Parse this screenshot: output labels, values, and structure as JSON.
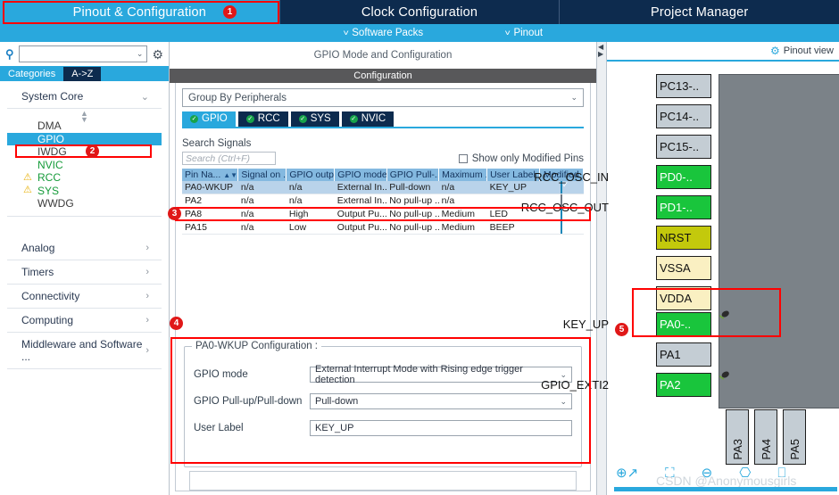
{
  "tabs": [
    {
      "label": "Pinout & Configuration",
      "active": true
    },
    {
      "label": "Clock Configuration",
      "active": false
    },
    {
      "label": "Project Manager",
      "active": false
    }
  ],
  "subbar": {
    "software_packs": "Software Packs",
    "pinout": "Pinout",
    "chevron": "˅"
  },
  "sidebar": {
    "search_value": "",
    "view_tabs": [
      {
        "label": "Categories",
        "active": false
      },
      {
        "label": "A->Z",
        "active": true
      }
    ],
    "groups": [
      {
        "label": "System Core",
        "expanded": true,
        "items": [
          {
            "label": "DMA",
            "state": "normal"
          },
          {
            "label": "GPIO",
            "state": "selected"
          },
          {
            "label": "IWDG",
            "state": "normal"
          },
          {
            "label": "NVIC",
            "state": "configured"
          },
          {
            "label": "RCC",
            "state": "warning"
          },
          {
            "label": "SYS",
            "state": "warning"
          },
          {
            "label": "WWDG",
            "state": "normal"
          }
        ]
      },
      {
        "label": "Analog",
        "expanded": false,
        "items": []
      },
      {
        "label": "Timers",
        "expanded": false,
        "items": []
      },
      {
        "label": "Connectivity",
        "expanded": false,
        "items": []
      },
      {
        "label": "Computing",
        "expanded": false,
        "items": []
      },
      {
        "label": "Middleware and Software ...",
        "expanded": false,
        "items": []
      }
    ]
  },
  "center": {
    "mode_header": "GPIO Mode and Configuration",
    "config_header": "Configuration",
    "group_by": "Group By Peripherals",
    "peripheral_tabs": [
      {
        "label": "GPIO",
        "active": true
      },
      {
        "label": "RCC",
        "active": false
      },
      {
        "label": "SYS",
        "active": false
      },
      {
        "label": "NVIC",
        "active": false
      }
    ],
    "search_label": "Search Signals",
    "search_placeholder": "Search (Ctrl+F)",
    "show_modified_label": "Show only Modified Pins",
    "show_modified_checked": false,
    "table": {
      "headers": [
        "Pin Na...",
        "Signal on ...",
        "GPIO outp...",
        "GPIO mode",
        "GPIO Pull-...",
        "Maximum ...",
        "User Label",
        "Modified"
      ],
      "rows": [
        {
          "cells": [
            "PA0-WKUP",
            "n/a",
            "n/a",
            "External In...",
            "Pull-down",
            "n/a",
            "KEY_UP"
          ],
          "modified": true,
          "selected": true
        },
        {
          "cells": [
            "PA2",
            "n/a",
            "n/a",
            "External In...",
            "No pull-up ...",
            "n/a",
            ""
          ],
          "modified": false,
          "selected": false
        },
        {
          "cells": [
            "PA8",
            "n/a",
            "High",
            "Output Pu...",
            "No pull-up ...",
            "Medium",
            "LED"
          ],
          "modified": true,
          "selected": false
        },
        {
          "cells": [
            "PA15",
            "n/a",
            "Low",
            "Output Pu...",
            "No pull-up ...",
            "Medium",
            "BEEP"
          ],
          "modified": true,
          "selected": false
        }
      ]
    },
    "config": {
      "title": "PA0-WKUP Configuration :",
      "fields": [
        {
          "label": "GPIO mode",
          "value": "External Interrupt Mode with Rising edge trigger detection",
          "type": "select"
        },
        {
          "label": "GPIO Pull-up/Pull-down",
          "value": "Pull-down",
          "type": "select"
        },
        {
          "label": "User Label",
          "value": "KEY_UP",
          "type": "text"
        }
      ]
    }
  },
  "pinout": {
    "view_label": "Pinout view",
    "left_pins": [
      {
        "name": "PC13-..",
        "color": "grey",
        "label": "",
        "tack": false
      },
      {
        "name": "PC14-..",
        "color": "grey",
        "label": "",
        "tack": false
      },
      {
        "name": "PC15-..",
        "color": "grey",
        "label": "",
        "tack": false
      },
      {
        "name": "PD0-..",
        "color": "green",
        "label": "RCC_OSC_IN",
        "tack": false
      },
      {
        "name": "PD1-..",
        "color": "green",
        "label": "RCC_OSC_OUT",
        "tack": false
      },
      {
        "name": "NRST",
        "color": "olive",
        "label": "",
        "tack": false
      },
      {
        "name": "VSSA",
        "color": "cream",
        "label": "",
        "tack": false
      },
      {
        "name": "VDDA",
        "color": "cream",
        "label": "",
        "tack": false
      },
      {
        "name": "PA0-..",
        "color": "green",
        "label": "KEY_UP",
        "tack": true
      },
      {
        "name": "PA1",
        "color": "grey",
        "label": "",
        "tack": false
      },
      {
        "name": "PA2",
        "color": "green",
        "label": "GPIO_EXTI2",
        "tack": true
      }
    ],
    "bottom_pins": [
      "PA3",
      "PA4",
      "PA5"
    ],
    "toolbar_icons": [
      "zoom-in",
      "fit-to-screen",
      "zoom-out",
      "rotate-left",
      "rotate-right"
    ],
    "watermark": "CSDN @Anonymousgirls"
  },
  "annotations": [
    {
      "number": "1"
    },
    {
      "number": "2"
    },
    {
      "number": "3"
    },
    {
      "number": "4"
    },
    {
      "number": "5"
    }
  ],
  "colors": {
    "accent": "#29a8dd",
    "navy": "#0d2b4e",
    "annotation": "#ff0000"
  }
}
